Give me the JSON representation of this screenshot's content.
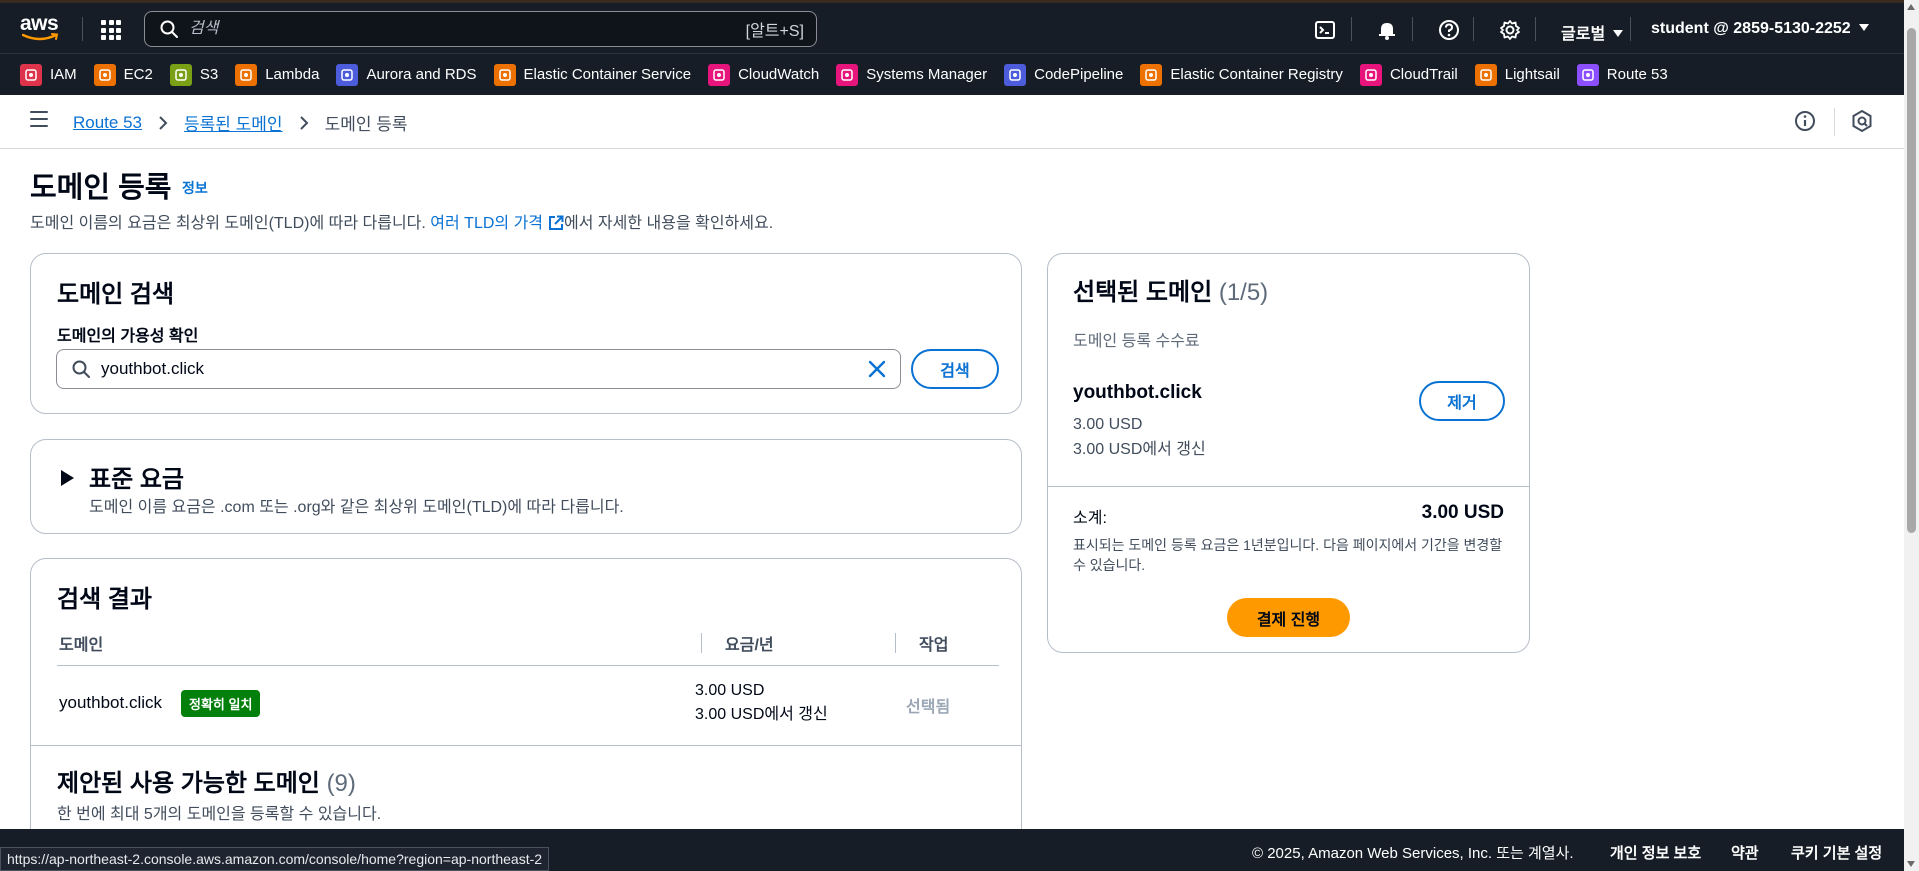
{
  "topnav": {
    "logo": "aws",
    "search_placeholder": "검색",
    "search_shortcut": "[알트+S]",
    "region": "글로벌",
    "account": "student @ 2859-5130-2252"
  },
  "favorites": [
    {
      "label": "IAM",
      "color": "#dd344c",
      "icon": "iam-icon"
    },
    {
      "label": "EC2",
      "color": "#ed7100",
      "icon": "ec2-icon"
    },
    {
      "label": "S3",
      "color": "#7aa116",
      "icon": "s3-icon"
    },
    {
      "label": "Lambda",
      "color": "#ed7100",
      "icon": "lambda-icon"
    },
    {
      "label": "Aurora and RDS",
      "color": "#4d5cdb",
      "icon": "rds-icon"
    },
    {
      "label": "Elastic Container Service",
      "color": "#ed7100",
      "icon": "ecs-icon"
    },
    {
      "label": "CloudWatch",
      "color": "#e7157b",
      "icon": "cloudwatch-icon"
    },
    {
      "label": "Systems Manager",
      "color": "#e7157b",
      "icon": "systems-manager-icon"
    },
    {
      "label": "CodePipeline",
      "color": "#4d5cdb",
      "icon": "codepipeline-icon"
    },
    {
      "label": "Elastic Container Registry",
      "color": "#ed7100",
      "icon": "ecr-icon"
    },
    {
      "label": "CloudTrail",
      "color": "#e7157b",
      "icon": "cloudtrail-icon"
    },
    {
      "label": "Lightsail",
      "color": "#ed7100",
      "icon": "lightsail-icon"
    },
    {
      "label": "Route 53",
      "color": "#8c4fff",
      "icon": "route53-icon"
    }
  ],
  "breadcrumb": {
    "root": "Route 53",
    "parent": "등록된 도메인",
    "current": "도메인 등록"
  },
  "page": {
    "title": "도메인 등록",
    "info": "정보",
    "desc_prefix": "도메인 이름의 요금은 최상위 도메인(TLD)에 따라 다릅니다. ",
    "desc_link": "여러 TLD의 가격",
    "desc_suffix": "에서 자세한 내용을 확인하세요."
  },
  "search_card": {
    "title": "도메인 검색",
    "label": "도메인의 가용성 확인",
    "value": "youthbot.click",
    "button": "검색"
  },
  "standard_pricing": {
    "title": "표준 요금",
    "desc": "도메인 이름 요금은 .com 또는 .org와 같은 최상위 도메인(TLD)에 따라 다릅니다."
  },
  "results": {
    "title": "검색 결과",
    "columns": [
      "도메인",
      "요금/년",
      "작업"
    ],
    "row": {
      "domain": "youthbot.click",
      "badge": "정확히 일치",
      "price": "3.00 USD",
      "renew": "3.00 USD에서 갱신",
      "action": "선택됨"
    },
    "suggested_title": "제안된 사용 가능한 도메인",
    "suggested_count": "(9)",
    "suggested_desc": "한 번에 최대 5개의 도메인을 등록할 수 있습니다."
  },
  "selected": {
    "title": "선택된 도메인",
    "count": "(1/5)",
    "fee_label": "도메인 등록 수수료",
    "domain": "youthbot.click",
    "price": "3.00 USD",
    "renew": "3.00 USD에서 갱신",
    "remove": "제거",
    "subtotal_label": "소계:",
    "subtotal_value": "3.00 USD",
    "note": "표시되는 도메인 등록 요금은 1년분입니다. 다음 페이지에서 기간을 변경할 수 있습니다.",
    "pay": "결제 진행"
  },
  "footer": {
    "copyright": "© 2025, Amazon Web Services, Inc. 또는 계열사.",
    "privacy": "개인 정보 보호",
    "terms": "약관",
    "cookies": "쿠키 기본 설정"
  },
  "status_url": "https://ap-northeast-2.console.aws.amazon.com/console/home?region=ap-northeast-2"
}
